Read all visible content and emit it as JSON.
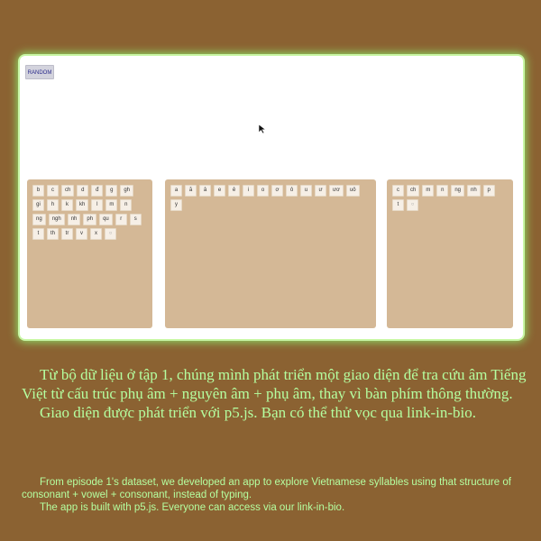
{
  "app": {
    "random_label": "RANDOM",
    "colors": {
      "background": "#8b6232",
      "panel": "#d4b896",
      "key": "#f6efe6",
      "glow": "#8fe26a",
      "caption": "#b5ffa0"
    },
    "panels": {
      "consonants": [
        "b",
        "c",
        "ch",
        "d",
        "đ",
        "g",
        "gh",
        "gi",
        "h",
        "k",
        "kh",
        "l",
        "m",
        "n",
        "ng",
        "ngh",
        "nh",
        "ph",
        "qu",
        "r",
        "s",
        "t",
        "th",
        "tr",
        "v",
        "x",
        "○"
      ],
      "vowels": [
        "a",
        "ă",
        "â",
        "e",
        "ê",
        "i",
        "o",
        "ơ",
        "ô",
        "u",
        "ư",
        "ươ",
        "uô",
        "y"
      ],
      "finals": [
        "c",
        "ch",
        "m",
        "n",
        "ng",
        "nh",
        "p",
        "t",
        "○"
      ]
    },
    "cursor_icon": "arrow-cursor-icon"
  },
  "caption": {
    "vi_line1": "Từ bộ dữ liệu ở tập 1, chúng mình phát triển một giao diện để tra cứu âm Tiếng Việt từ cấu trúc phụ âm + nguyên âm + phụ âm, thay vì bàn phím thông thường.",
    "vi_line2": "Giao diện được phát triển với p5.js. Bạn có thể thử vọc qua link-in-bio.",
    "en_line1": "From episode 1's dataset, we developed an app to explore Vietnamese syllables using that structure of consonant + vowel + consonant, instead of typing.",
    "en_line2": "The app is built with p5.js. Everyone can access via our link-in-bio."
  }
}
